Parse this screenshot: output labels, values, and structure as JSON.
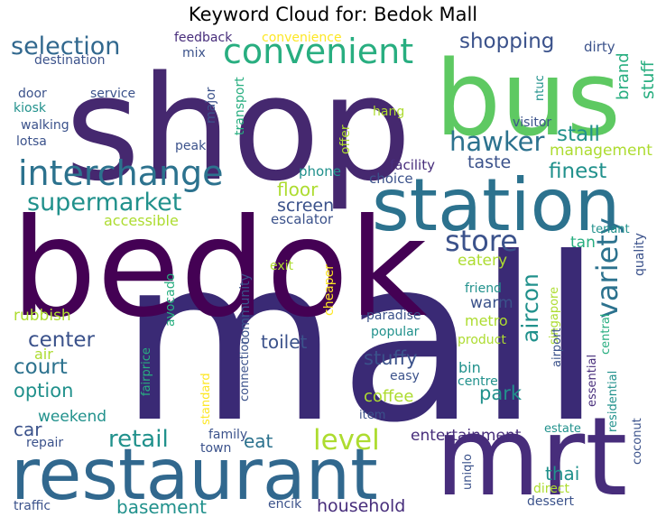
{
  "title": "Keyword Cloud for: Bedok Mall",
  "colors": {
    "d1": "#440154",
    "d2": "#472d7b",
    "d3": "#3b528b",
    "t1": "#2c728e",
    "t2": "#21918c",
    "g1": "#28ae80",
    "g2": "#5ec962",
    "g3": "#addc30",
    "y": "#fde725"
  },
  "words": [
    {
      "text": "mall",
      "c": "#3a2a75"
    },
    {
      "text": "shop",
      "c": "#45286f"
    },
    {
      "text": "bedok",
      "c": "#440154"
    },
    {
      "text": "bus",
      "c": "#5ec962"
    },
    {
      "text": "station",
      "c": "#2c728e"
    },
    {
      "text": "mrt",
      "c": "#472d7b"
    },
    {
      "text": "restaurant",
      "c": "#31688e"
    },
    {
      "text": "interchange",
      "c": "#2c728e"
    },
    {
      "text": "convenient",
      "c": "#28ae80"
    },
    {
      "text": "selection",
      "c": "#31688e"
    },
    {
      "text": "supermarket",
      "c": "#21918c"
    },
    {
      "text": "hawker",
      "c": "#2c728e"
    },
    {
      "text": "store",
      "c": "#3b528b"
    },
    {
      "text": "variety",
      "c": "#2c728e"
    },
    {
      "text": "shopping",
      "c": "#3b528b"
    },
    {
      "text": "level",
      "c": "#addc30"
    },
    {
      "text": "stall",
      "c": "#21918c"
    },
    {
      "text": "finest",
      "c": "#21918c"
    },
    {
      "text": "brand",
      "c": "#28ae80"
    },
    {
      "text": "stuff",
      "c": "#28ae80"
    },
    {
      "text": "aircon",
      "c": "#21918c"
    },
    {
      "text": "retail",
      "c": "#21918c"
    },
    {
      "text": "court",
      "c": "#2c728e"
    },
    {
      "text": "center",
      "c": "#3b528b"
    },
    {
      "text": "option",
      "c": "#21918c"
    },
    {
      "text": "park",
      "c": "#21918c"
    },
    {
      "text": "basement",
      "c": "#21918c"
    },
    {
      "text": "household",
      "c": "#472d7b"
    },
    {
      "text": "eat",
      "c": "#2c728e"
    },
    {
      "text": "thai",
      "c": "#21918c"
    },
    {
      "text": "floor",
      "c": "#addc30"
    },
    {
      "text": "screen",
      "c": "#3b528b"
    },
    {
      "text": "taste",
      "c": "#3b528b"
    },
    {
      "text": "management",
      "c": "#addc30"
    },
    {
      "text": "stuffy",
      "c": "#3b528b"
    },
    {
      "text": "toilet",
      "c": "#3b528b"
    },
    {
      "text": "car",
      "c": "#3b528b"
    },
    {
      "text": "coffee",
      "c": "#addc30"
    },
    {
      "text": "weekend",
      "c": "#21918c"
    },
    {
      "text": "entertainment",
      "c": "#472d7b"
    },
    {
      "text": "tan",
      "c": "#28ae80"
    },
    {
      "text": "eatery",
      "c": "#addc30"
    },
    {
      "text": "warm",
      "c": "#3b528b"
    },
    {
      "text": "metro",
      "c": "#addc30"
    },
    {
      "text": "bin",
      "c": "#21918c"
    },
    {
      "text": "rubbish",
      "c": "#addc30"
    },
    {
      "text": "air",
      "c": "#addc30"
    },
    {
      "text": "accessible",
      "c": "#addc30"
    },
    {
      "text": "escalator",
      "c": "#3b528b"
    },
    {
      "text": "avocado",
      "c": "#28ae80"
    },
    {
      "text": "community",
      "c": "#3b528b"
    },
    {
      "text": "cheaper",
      "c": "#fde725"
    },
    {
      "text": "exit",
      "c": "#addc30"
    },
    {
      "text": "phone",
      "c": "#21918c"
    },
    {
      "text": "facility",
      "c": "#472d7b"
    },
    {
      "text": "choice",
      "c": "#3b528b"
    },
    {
      "text": "dirty",
      "c": "#3b528b"
    },
    {
      "text": "ntuc",
      "c": "#21918c"
    },
    {
      "text": "visitor",
      "c": "#3b528b"
    },
    {
      "text": "hang",
      "c": "#addc30"
    },
    {
      "text": "offer",
      "c": "#addc30"
    },
    {
      "text": "peak",
      "c": "#3b528b"
    },
    {
      "text": "major",
      "c": "#3b528b"
    },
    {
      "text": "transport",
      "c": "#28ae80"
    },
    {
      "text": "service",
      "c": "#3b528b"
    },
    {
      "text": "door",
      "c": "#3b528b"
    },
    {
      "text": "kiosk",
      "c": "#21918c"
    },
    {
      "text": "walking",
      "c": "#3b528b"
    },
    {
      "text": "lotsa",
      "c": "#3b528b"
    },
    {
      "text": "destination",
      "c": "#3b528b"
    },
    {
      "text": "feedback",
      "c": "#472d7b"
    },
    {
      "text": "mix",
      "c": "#3b528b"
    },
    {
      "text": "convenience",
      "c": "#fde725"
    },
    {
      "text": "tenant",
      "c": "#21918c"
    },
    {
      "text": "quality",
      "c": "#3b528b"
    },
    {
      "text": "friend",
      "c": "#21918c"
    },
    {
      "text": "singapore",
      "c": "#addc30"
    },
    {
      "text": "paradise",
      "c": "#3b528b"
    },
    {
      "text": "popular",
      "c": "#21918c"
    },
    {
      "text": "product",
      "c": "#addc30"
    },
    {
      "text": "easy",
      "c": "#3b528b"
    },
    {
      "text": "airport",
      "c": "#3b528b"
    },
    {
      "text": "central",
      "c": "#28ae80"
    },
    {
      "text": "essential",
      "c": "#472d7b"
    },
    {
      "text": "residential",
      "c": "#21918c"
    },
    {
      "text": "centre",
      "c": "#21918c"
    },
    {
      "text": "item",
      "c": "#3b528b"
    },
    {
      "text": "estate",
      "c": "#21918c"
    },
    {
      "text": "coconut",
      "c": "#3b528b"
    },
    {
      "text": "uniqlo",
      "c": "#3b528b"
    },
    {
      "text": "direct",
      "c": "#addc30"
    },
    {
      "text": "dessert",
      "c": "#3b528b"
    },
    {
      "text": "encik",
      "c": "#3b528b"
    },
    {
      "text": "traffic",
      "c": "#3b528b"
    },
    {
      "text": "repair",
      "c": "#3b528b"
    },
    {
      "text": "family",
      "c": "#3b528b"
    },
    {
      "text": "town",
      "c": "#3b528b"
    },
    {
      "text": "standard",
      "c": "#fde725"
    },
    {
      "text": "fairprice",
      "c": "#28ae80"
    },
    {
      "text": "connection",
      "c": "#3b528b"
    }
  ]
}
